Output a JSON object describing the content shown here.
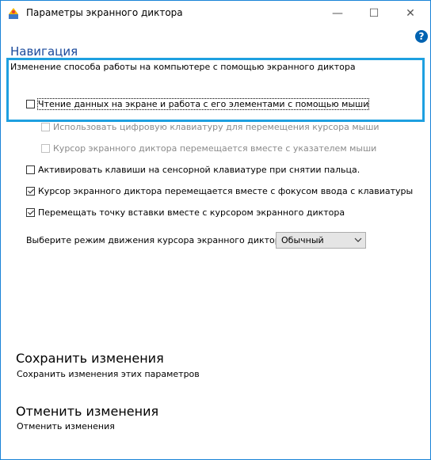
{
  "window": {
    "title": "Параметры экранного диктора",
    "minimize_glyph": "—",
    "maximize_glyph": "☐",
    "close_glyph": "✕",
    "help_glyph": "?"
  },
  "section": {
    "title": "Навигация",
    "description": "Изменение способа работы на компьютере с помощью экранного диктора"
  },
  "options": [
    {
      "label": "Чтение данных на экране и работа с его элементами с помощью мыши",
      "checked": false,
      "enabled": true
    },
    {
      "label": "Использовать цифровую клавиатуру для перемещения курсора мыши",
      "checked": false,
      "enabled": false
    },
    {
      "label": "Курсор экранного диктора перемещается вместе с указателем мыши",
      "checked": false,
      "enabled": false
    },
    {
      "label": "Активировать клавиши на сенсорной клавиатуре при снятии пальца.",
      "checked": false,
      "enabled": true
    },
    {
      "label": "Курсор экранного диктора перемещается вместе с фокусом ввода с клавиатуры",
      "checked": true,
      "enabled": true
    },
    {
      "label": "Перемещать точку вставки вместе с курсором экранного диктора",
      "checked": true,
      "enabled": true
    }
  ],
  "mode": {
    "label": "Выберите режим движения курсора экранного диктора:",
    "value": "Обычный"
  },
  "save": {
    "title": "Сохранить изменения",
    "description": "Сохранить изменения этих параметров"
  },
  "cancel": {
    "title": "Отменить изменения",
    "description": "Отменить изменения"
  }
}
